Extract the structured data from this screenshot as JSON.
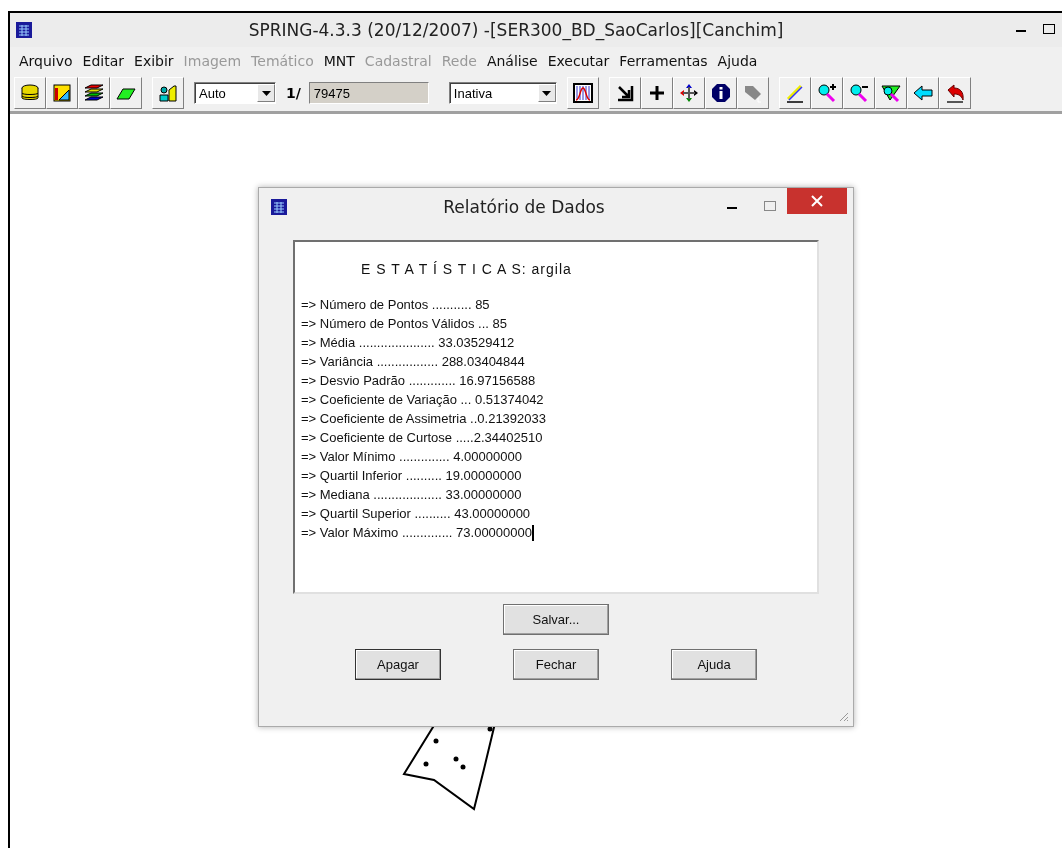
{
  "window": {
    "title": "SPRING-4.3.3 (20/12/2007) -[SER300_BD_SaoCarlos][Canchim]"
  },
  "menu": [
    {
      "label": "Arquivo",
      "disabled": false
    },
    {
      "label": "Editar",
      "disabled": false
    },
    {
      "label": "Exibir",
      "disabled": false
    },
    {
      "label": "Imagem",
      "disabled": true
    },
    {
      "label": "Temático",
      "disabled": true
    },
    {
      "label": "MNT",
      "disabled": false
    },
    {
      "label": "Cadastral",
      "disabled": true
    },
    {
      "label": "Rede",
      "disabled": true
    },
    {
      "label": "Análise",
      "disabled": false
    },
    {
      "label": "Executar",
      "disabled": false
    },
    {
      "label": "Ferramentas",
      "disabled": false
    },
    {
      "label": "Ajuda",
      "disabled": false
    }
  ],
  "toolbar": {
    "scale_mode": "Auto",
    "scale_prefix": "1/",
    "scale_value": "79475",
    "state": "Inativa"
  },
  "dialog": {
    "title": "Relatório de Dados",
    "heading": "E S T A T Í S T I C A S: argila",
    "lines": [
      "=> Número de Pontos ........... 85",
      "=> Número de Pontos Válidos ... 85",
      "=> Média ..................... 33.03529412",
      "=> Variância ................. 288.03404844",
      "=> Desvio Padrão ............. 16.97156588",
      "=> Coeficiente de Variação ... 0.51374042",
      "=> Coeficiente de Assimetria ..0.21392033",
      "=> Coeficiente de Curtose .....2.34402510",
      "=> Valor Mínimo .............. 4.00000000",
      "=> Quartil Inferior .......... 19.00000000",
      "=> Mediana ................... 33.00000000",
      "=> Quartil Superior .......... 43.00000000",
      "=> Valor Máximo .............. 73.00000000"
    ],
    "save_button": "Salvar...",
    "buttons": [
      "Apagar",
      "Fechar",
      "Ajuda"
    ]
  }
}
